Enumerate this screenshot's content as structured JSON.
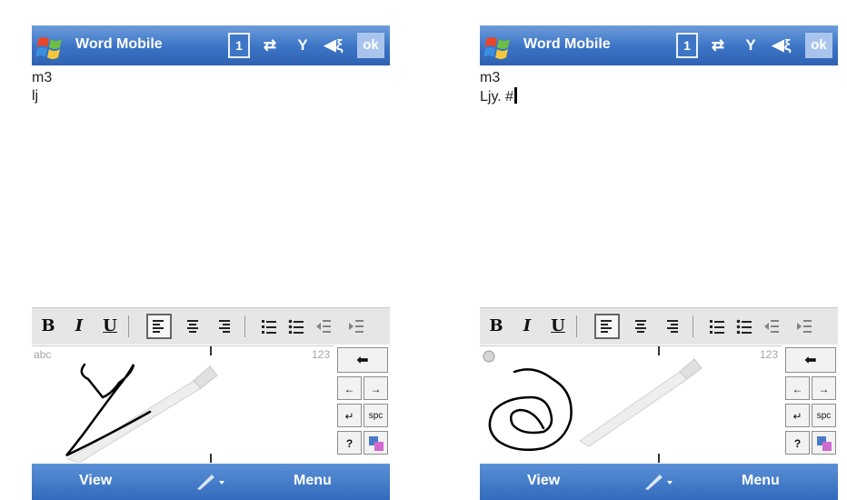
{
  "screens": {
    "left": {
      "app_title": "Word Mobile",
      "doc_lines": [
        "m3",
        "lj"
      ],
      "show_caret": false,
      "input_mode_label": "abc",
      "softkeys": {
        "left": "View",
        "right": "Menu"
      }
    },
    "right": {
      "app_title": "Word Mobile",
      "doc_lines": [
        "m3",
        "Ljy. #"
      ],
      "show_caret": true,
      "input_mode_label": "",
      "softkeys": {
        "left": "View",
        "right": "Menu"
      }
    }
  },
  "status_icons": [
    "window-icon",
    "sync-icon",
    "signal-icon",
    "volume-icon"
  ],
  "ok_label": "ok",
  "format_toolbar": {
    "bold": "B",
    "italic": "I",
    "underline": "U",
    "align_icons": [
      "align-left-icon",
      "align-center-icon",
      "align-right-icon"
    ],
    "list_icons": [
      "numbered-list-icon",
      "bullet-list-icon",
      "decrease-indent-icon",
      "increase-indent-icon"
    ],
    "selected": "align-left-icon"
  },
  "recognizer": {
    "numbers_label": "123",
    "keys": [
      "←",
      "→",
      "↵",
      "spc",
      "?"
    ],
    "top_key": "⬅"
  },
  "colors": {
    "titlebar": "#3b73c4",
    "toolbar": "#e6e6e6",
    "ink": "#000000"
  }
}
